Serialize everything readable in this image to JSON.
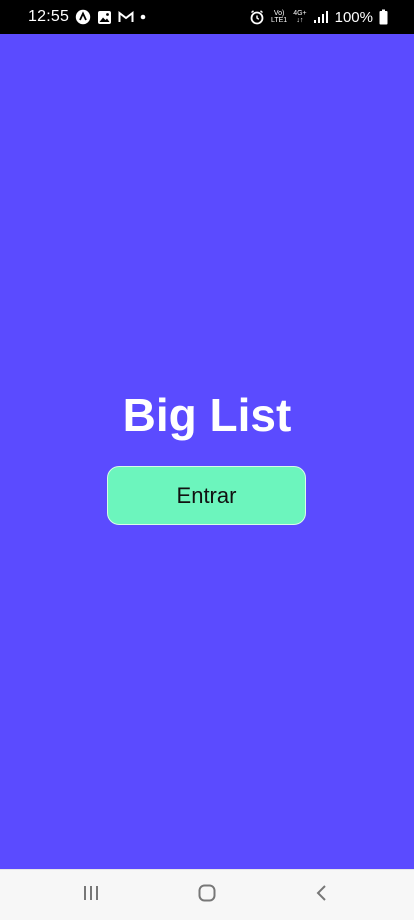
{
  "status_bar": {
    "time": "12:55",
    "battery": "100%",
    "network_top": "Vo)",
    "network_bottom": "LTE1",
    "network_gen": "4G+",
    "left_icons": [
      "android-icon",
      "gallery-icon",
      "gmail-icon",
      "notification-dot-icon"
    ],
    "right_icons": [
      "alarm-icon",
      "signal-icon",
      "battery-icon"
    ]
  },
  "main": {
    "title": "Big List",
    "enter_button_label": "Entrar"
  },
  "nav_bar": {
    "buttons": [
      "recent-apps-icon",
      "home-icon",
      "back-icon"
    ]
  },
  "colors": {
    "background": "#5B4BFF",
    "button": "#6CF5BD",
    "title_text": "#FFFFFF",
    "button_text": "#111111",
    "status_bar": "#000000",
    "nav_bar": "#F7F7F7"
  }
}
